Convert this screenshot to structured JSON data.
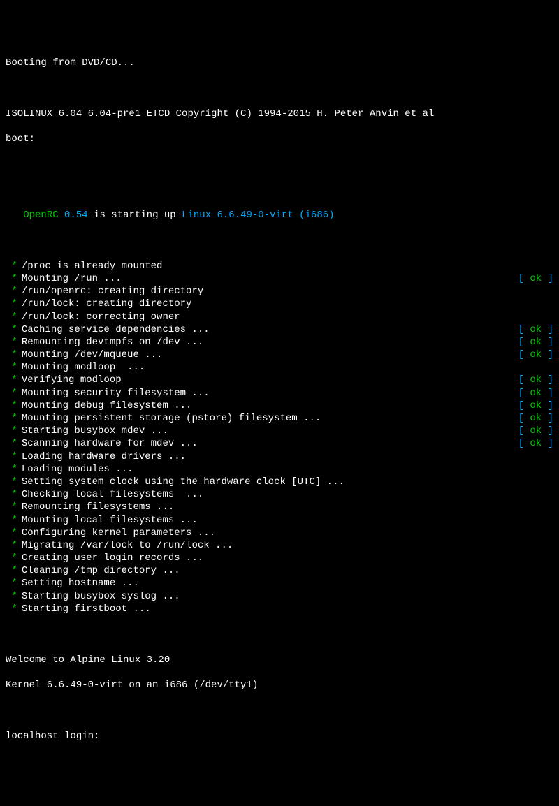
{
  "header": {
    "booting": "Booting from DVD/CD...",
    "isolinux": "ISOLINUX 6.04 6.04-pre1 ETCD Copyright (C) 1994-2015 H. Peter Anvin et al",
    "boot_prompt": "boot:"
  },
  "openrc_line": {
    "openrc": "OpenRC",
    "version": "0.54",
    "starting": "is starting up",
    "kernel": "Linux 6.6.49-0-virt (i686)"
  },
  "lines": [
    {
      "msg": "/proc is already mounted",
      "status": ""
    },
    {
      "msg": "Mounting /run ...",
      "status": "ok"
    },
    {
      "msg": "/run/openrc: creating directory",
      "status": ""
    },
    {
      "msg": "/run/lock: creating directory",
      "status": ""
    },
    {
      "msg": "/run/lock: correcting owner",
      "status": ""
    },
    {
      "msg": "Caching service dependencies ...",
      "status": "ok"
    },
    {
      "msg": "Remounting devtmpfs on /dev ...",
      "status": "ok"
    },
    {
      "msg": "Mounting /dev/mqueue ...",
      "status": "ok"
    },
    {
      "msg": "Mounting modloop  ...",
      "status": ""
    },
    {
      "msg": "Verifying modloop",
      "status": "ok"
    },
    {
      "msg": "Mounting security filesystem ...",
      "status": "ok"
    },
    {
      "msg": "Mounting debug filesystem ...",
      "status": "ok"
    },
    {
      "msg": "Mounting persistent storage (pstore) filesystem ...",
      "status": "ok"
    },
    {
      "msg": "Starting busybox mdev ...",
      "status": "ok"
    },
    {
      "msg": "Scanning hardware for mdev ...",
      "status": "ok"
    },
    {
      "msg": "Loading hardware drivers ...",
      "status": ""
    },
    {
      "msg": "Loading modules ...",
      "status": ""
    },
    {
      "msg": "Setting system clock using the hardware clock [UTC] ...",
      "status": ""
    },
    {
      "msg": "Checking local filesystems  ...",
      "status": ""
    },
    {
      "msg": "Remounting filesystems ...",
      "status": ""
    },
    {
      "msg": "Mounting local filesystems ...",
      "status": ""
    },
    {
      "msg": "Configuring kernel parameters ...",
      "status": ""
    },
    {
      "msg": "Migrating /var/lock to /run/lock ...",
      "status": ""
    },
    {
      "msg": "Creating user login records ...",
      "status": ""
    },
    {
      "msg": "Cleaning /tmp directory ...",
      "status": ""
    },
    {
      "msg": "Setting hostname ...",
      "status": ""
    },
    {
      "msg": "Starting busybox syslog ...",
      "status": ""
    },
    {
      "msg": "Starting firstboot ...",
      "status": ""
    }
  ],
  "footer": {
    "welcome": "Welcome to Alpine Linux 3.20",
    "kernel": "Kernel 6.6.49-0-virt on an i686 (/dev/tty1)",
    "login_prompt": "localhost login:"
  },
  "status_fmt": {
    "lbr": "[ ",
    "ok": "ok",
    "rbr": " ]"
  }
}
